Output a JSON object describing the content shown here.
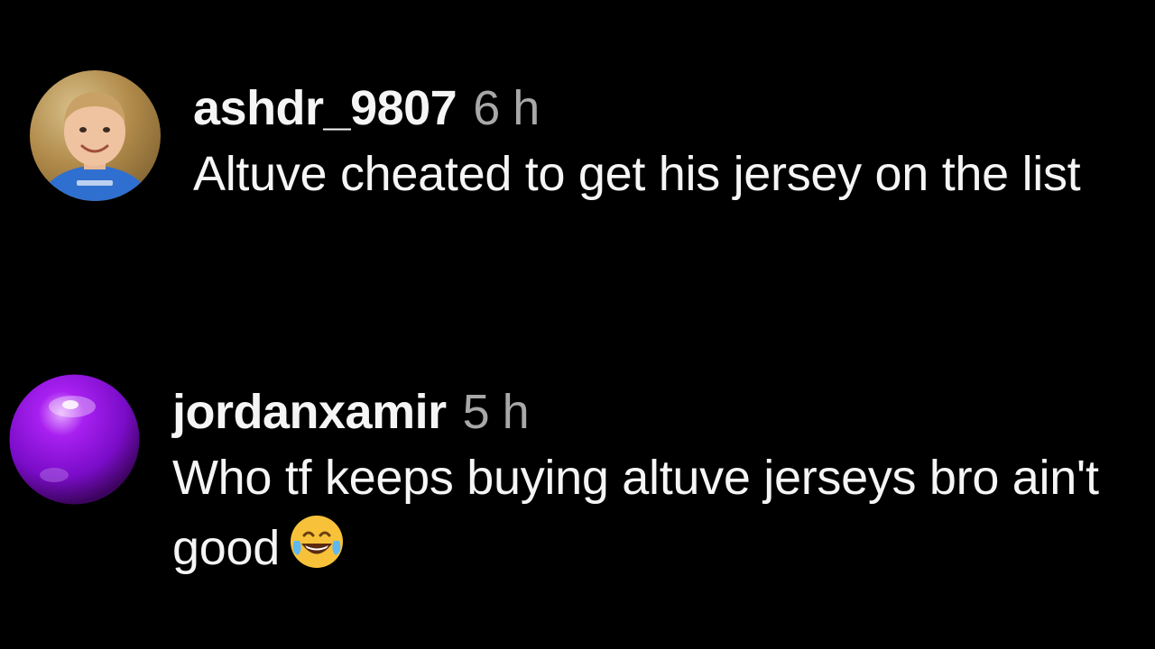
{
  "comments": [
    {
      "username": "ashdr_9807",
      "timestamp": "6 h",
      "text": "Altuve cheated to get his jersey on the list",
      "avatar_icon": "child-photo-avatar-icon"
    },
    {
      "username": "jordanxamir",
      "timestamp": "5 h",
      "text": "Who tf keeps buying altuve jerseys bro ain't good",
      "avatar_icon": "purple-orb-avatar-icon",
      "trailing_emoji": "face-with-tears-of-joy-icon"
    }
  ],
  "colors": {
    "background": "#000000",
    "text": "#f5f5f5",
    "timestamp": "#a8a8a8",
    "orb_purple": "#8a12d8"
  }
}
